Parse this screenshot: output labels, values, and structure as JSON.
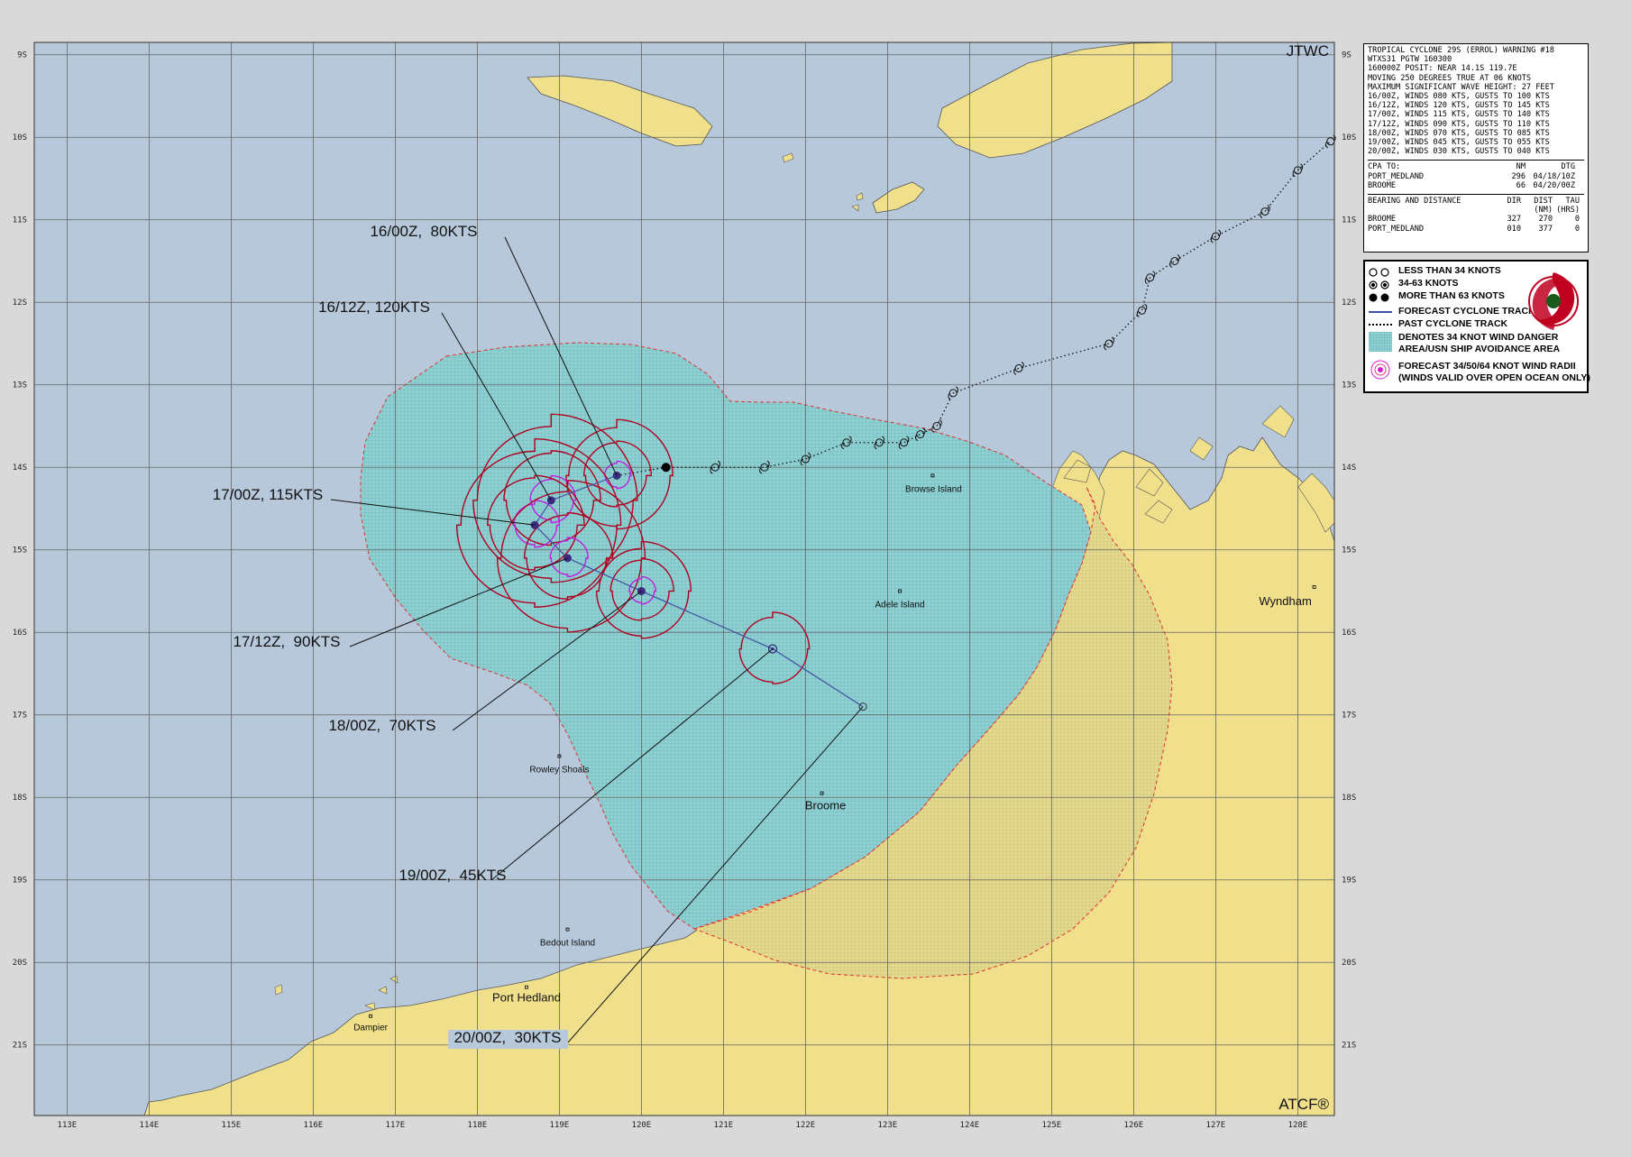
{
  "header": {
    "agency": "JTWC",
    "footer": "ATCF®"
  },
  "warning": {
    "lines": [
      "TROPICAL CYCLONE 29S (ERROL) WARNING #18",
      "WTXS31 PGTW 160300",
      "160000Z POSIT: NEAR 14.1S 119.7E",
      "MOVING 250 DEGREES TRUE AT 06 KNOTS",
      "MAXIMUM SIGNIFICANT WAVE HEIGHT: 27 FEET",
      "16/00Z, WINDS 080 KTS, GUSTS TO 100 KTS",
      "16/12Z, WINDS 120 KTS, GUSTS TO 145 KTS",
      "17/00Z, WINDS 115 KTS, GUSTS TO 140 KTS",
      "17/12Z, WINDS 090 KTS, GUSTS TO 110 KTS",
      "18/00Z, WINDS 070 KTS, GUSTS TO 085 KTS",
      "19/00Z, WINDS 045 KTS, GUSTS TO 055 KTS",
      "20/00Z, WINDS 030 KTS, GUSTS TO 040 KTS"
    ],
    "cpa_header": [
      "CPA TO:",
      "NM",
      "DTG"
    ],
    "cpa_rows": [
      [
        "PORT_MEDLAND",
        "296",
        "04/18/10Z"
      ],
      [
        "BROOME",
        "66",
        "04/20/00Z"
      ]
    ],
    "bd_header": [
      "BEARING AND DISTANCE",
      "DIR",
      "DIST",
      "TAU"
    ],
    "bd_header2": [
      "",
      "",
      "(NM)",
      "(HRS)"
    ],
    "bd_rows": [
      [
        "BROOME",
        "327",
        "270",
        "0"
      ],
      [
        "PORT_MEDLAND",
        "010",
        "377",
        "0"
      ]
    ]
  },
  "legend": {
    "items": [
      "LESS THAN 34 KNOTS",
      "34-63 KNOTS",
      "MORE THAN 63 KNOTS",
      "FORECAST CYCLONE TRACK",
      "PAST CYCLONE TRACK",
      "DENOTES 34 KNOT WIND DANGER",
      "AREA/USN SHIP AVOIDANCE AREA",
      "FORECAST 34/50/64 KNOT WIND RADII",
      "(WINDS VALID OVER OPEN OCEAN ONLY)"
    ]
  },
  "axes": {
    "lon_labels": [
      "113E",
      "114E",
      "115E",
      "116E",
      "117E",
      "118E",
      "119E",
      "120E",
      "121E",
      "122E",
      "123E",
      "124E",
      "125E",
      "126E",
      "127E",
      "128E"
    ],
    "lat_labels": [
      "9S",
      "10S",
      "11S",
      "12S",
      "13S",
      "14S",
      "15S",
      "16S",
      "17S",
      "18S",
      "19S",
      "20S",
      "21S"
    ]
  },
  "places": [
    {
      "name": "Browse Island",
      "lon": 123.55,
      "lat": 14.1
    },
    {
      "name": "Adele Island",
      "lon": 123.15,
      "lat": 15.5
    },
    {
      "name": "Wyndham",
      "lon": 128.2,
      "lat": 15.45
    },
    {
      "name": "Rowley Shoals",
      "lon": 119.0,
      "lat": 17.5
    },
    {
      "name": "Broome",
      "lon": 122.2,
      "lat": 17.95
    },
    {
      "name": "Bedout Island",
      "lon": 119.1,
      "lat": 19.6
    },
    {
      "name": "Port Hedland",
      "lon": 118.6,
      "lat": 20.3
    },
    {
      "name": "Dampier",
      "lon": 116.7,
      "lat": 20.65
    }
  ],
  "forecast_points": [
    {
      "label": "16/00Z,  80KTS",
      "lon": 119.7,
      "lat": 14.1,
      "kts": 80
    },
    {
      "label": "16/12Z, 120KTS",
      "lon": 118.9,
      "lat": 14.4,
      "kts": 120
    },
    {
      "label": "17/00Z, 115KTS",
      "lon": 118.7,
      "lat": 14.7,
      "kts": 115
    },
    {
      "label": "17/12Z,  90KTS",
      "lon": 119.1,
      "lat": 15.1,
      "kts": 90
    },
    {
      "label": "18/00Z,  70KTS",
      "lon": 120.0,
      "lat": 15.5,
      "kts": 70
    },
    {
      "label": "19/00Z,  45KTS",
      "lon": 121.6,
      "lat": 16.2,
      "kts": 45
    },
    {
      "label": "20/00Z,  30KTS",
      "lon": 122.7,
      "lat": 16.9,
      "kts": 30
    }
  ],
  "past_track": [
    {
      "lon": 120.3,
      "lat": 14.0
    },
    {
      "lon": 120.9,
      "lat": 14.0
    },
    {
      "lon": 121.5,
      "lat": 14.0
    },
    {
      "lon": 122.0,
      "lat": 13.9
    },
    {
      "lon": 122.5,
      "lat": 13.7
    },
    {
      "lon": 122.9,
      "lat": 13.7
    },
    {
      "lon": 123.2,
      "lat": 13.7
    },
    {
      "lon": 123.4,
      "lat": 13.6
    },
    {
      "lon": 123.6,
      "lat": 13.5
    },
    {
      "lon": 123.8,
      "lat": 13.1
    },
    {
      "lon": 124.6,
      "lat": 12.8
    },
    {
      "lon": 125.7,
      "lat": 12.5
    },
    {
      "lon": 126.1,
      "lat": 12.1
    },
    {
      "lon": 126.2,
      "lat": 11.7
    },
    {
      "lon": 126.5,
      "lat": 11.5
    },
    {
      "lon": 127.0,
      "lat": 11.2
    },
    {
      "lon": 127.6,
      "lat": 10.9
    },
    {
      "lon": 128.0,
      "lat": 10.4
    },
    {
      "lon": 128.4,
      "lat": 10.05
    }
  ],
  "colors": {
    "ocean": "#b6c8da",
    "land": "#f0e08c",
    "danger_fill": "#7ec7cc",
    "danger_edge": "#e03030",
    "radii": "#b00020",
    "radii_inner": "#c020e0",
    "track": "#4050a0"
  }
}
